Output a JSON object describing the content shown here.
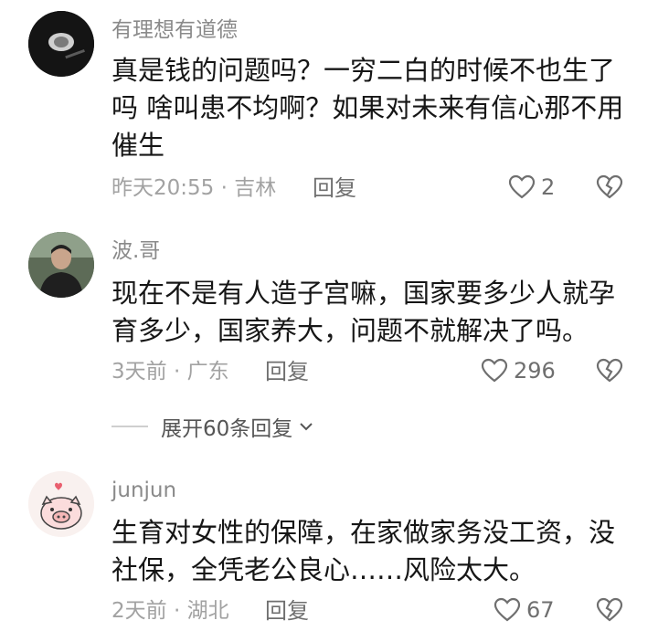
{
  "comments": [
    {
      "username": "有理想有道德",
      "text": "真是钱的问题吗？一穷二白的时候不也生了吗 啥叫患不均啊？如果对未来有信心那不用催生",
      "meta": "昨天20:55 · 吉林",
      "reply": "回复",
      "likes": "2"
    },
    {
      "username": "波.哥",
      "text": "现在不是有人造子宫嘛，国家要多少人就孕育多少，国家养大，问题不就解决了吗。",
      "meta": "3天前 · 广东",
      "reply": "回复",
      "likes": "296"
    },
    {
      "username": "junjun",
      "text": "生育对女性的保障，在家做家务没工资，没社保，全凭老公良心……风险太大。",
      "meta": "2天前 · 湖北",
      "reply": "回复",
      "likes": "67"
    }
  ],
  "expand_replies": "展开60条回复",
  "icons": {
    "like": "heart-outline-icon",
    "dislike": "broken-heart-icon",
    "expand": "chevron-down-icon"
  },
  "colors": {
    "text": "#161616",
    "secondary": "#8a8a8a",
    "icon": "#6f6f6f"
  }
}
